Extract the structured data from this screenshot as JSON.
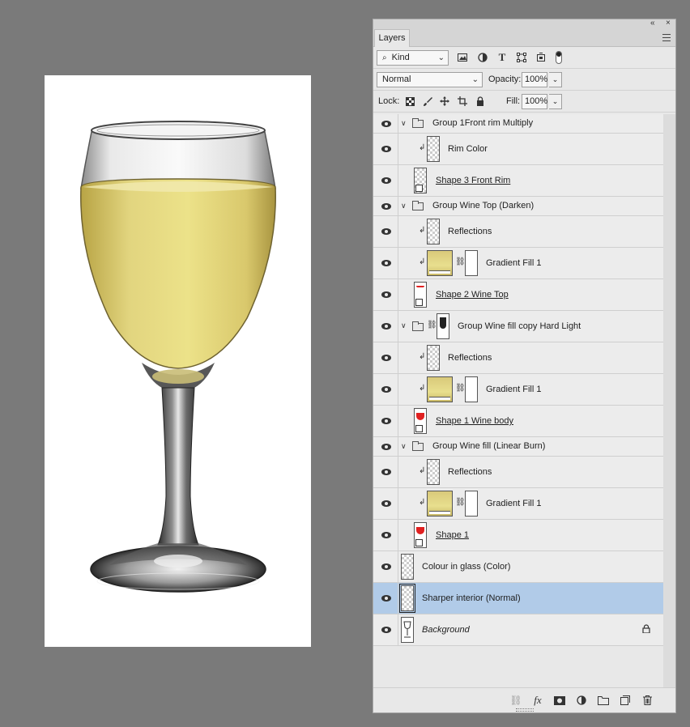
{
  "panel": {
    "tab_label": "Layers",
    "collapse_glyph": "«",
    "close_glyph": "×"
  },
  "filter": {
    "kind_label": "Kind",
    "icons": [
      "image-filter-icon",
      "adjustment-filter-icon",
      "type-filter-icon",
      "shape-filter-icon",
      "smart-object-filter-icon",
      "filter-toggle-icon"
    ]
  },
  "blend": {
    "mode": "Normal",
    "opacity_label": "Opacity:",
    "opacity_value": "100%"
  },
  "lock": {
    "label": "Lock:",
    "fill_label": "Fill:",
    "fill_value": "100%"
  },
  "layers": [
    {
      "name": "Group 1Front rim Multiply",
      "type": "group"
    },
    {
      "name": "Rim Color",
      "type": "clipped-pixel"
    },
    {
      "name": "Shape 3 Front Rim ",
      "type": "shape"
    },
    {
      "name": "Group Wine Top (Darken)",
      "type": "group"
    },
    {
      "name": "Reflections",
      "type": "clipped-pixel"
    },
    {
      "name": "Gradient Fill 1",
      "type": "clipped-gradient"
    },
    {
      "name": "Shape 2 Wine Top ",
      "type": "shape"
    },
    {
      "name": "Group Wine fill copy Hard Light",
      "type": "group-masked"
    },
    {
      "name": "Reflections",
      "type": "clipped-pixel"
    },
    {
      "name": "Gradient Fill 1",
      "type": "clipped-gradient"
    },
    {
      "name": "Shape 1 Wine body ",
      "type": "shape"
    },
    {
      "name": "Group Wine fill (Linear Burn)",
      "type": "group"
    },
    {
      "name": "Reflections",
      "type": "clipped-pixel"
    },
    {
      "name": "Gradient Fill 1",
      "type": "clipped-gradient"
    },
    {
      "name": "Shape 1 ",
      "type": "shape"
    },
    {
      "name": "Colour in glass (Color)",
      "type": "pixel"
    },
    {
      "name": "Sharper interior (Normal)",
      "type": "pixel",
      "selected": true
    },
    {
      "name": "Background",
      "type": "background"
    }
  ],
  "footer": {
    "icons": [
      "link-layers-icon",
      "fx-icon",
      "add-mask-icon",
      "adjustment-layer-icon",
      "new-group-icon",
      "new-layer-icon",
      "delete-layer-icon"
    ],
    "fx_label": "fx"
  },
  "colors": {
    "selected_row": "#b1cbe8",
    "wine": "#e8dc8a",
    "shape_marker": "#e02020"
  }
}
